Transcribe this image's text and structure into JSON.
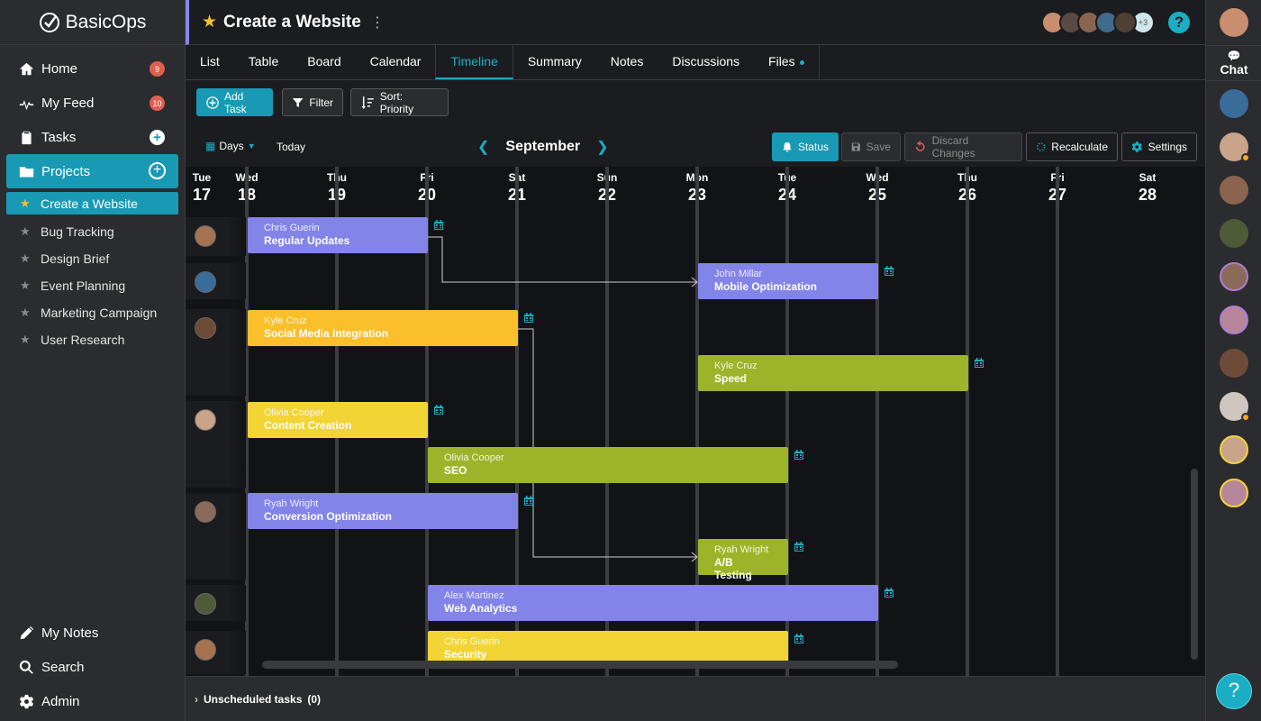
{
  "app": {
    "name": "BasicOps"
  },
  "sidebar": {
    "nav": [
      {
        "label": "Home",
        "icon": "home-icon",
        "badge": "9"
      },
      {
        "label": "My Feed",
        "icon": "activity-icon",
        "badge": "10"
      },
      {
        "label": "Tasks",
        "icon": "clipboard-icon"
      },
      {
        "label": "Projects",
        "icon": "folder-icon"
      }
    ],
    "projects": [
      {
        "label": "Create a Website",
        "starred": true
      },
      {
        "label": "Bug Tracking",
        "starred": false
      },
      {
        "label": "Design Brief",
        "starred": false
      },
      {
        "label": "Event Planning",
        "starred": false
      },
      {
        "label": "Marketing Campaign",
        "starred": false
      },
      {
        "label": "User Research",
        "starred": false
      }
    ],
    "bottom": [
      {
        "label": "My Notes",
        "icon": "pencil-icon"
      },
      {
        "label": "Search",
        "icon": "search-icon"
      },
      {
        "label": "Admin",
        "icon": "gear-icon"
      }
    ]
  },
  "header": {
    "title": "Create a Website",
    "more_members": "+3"
  },
  "tabs": [
    "List",
    "Table",
    "Board",
    "Calendar",
    "Timeline",
    "Summary",
    "Notes",
    "Discussions",
    "Files"
  ],
  "active_tab": "Timeline",
  "toolbar": {
    "add_task": "Add Task",
    "filter": "Filter",
    "sort": "Sort: Priority"
  },
  "timeline_controls": {
    "scale": "Days",
    "today": "Today",
    "month": "September",
    "status": "Status",
    "save": "Save",
    "discard": "Discard Changes",
    "recalculate": "Recalculate",
    "settings": "Settings"
  },
  "days": [
    {
      "dow": "Tue",
      "date": "17"
    },
    {
      "dow": "Wed",
      "date": "18"
    },
    {
      "dow": "Thu",
      "date": "19"
    },
    {
      "dow": "Fri",
      "date": "20"
    },
    {
      "dow": "Sat",
      "date": "21"
    },
    {
      "dow": "Sun",
      "date": "22"
    },
    {
      "dow": "Mon",
      "date": "23"
    },
    {
      "dow": "Tue",
      "date": "24"
    },
    {
      "dow": "Wed",
      "date": "25"
    },
    {
      "dow": "Thu",
      "date": "26"
    },
    {
      "dow": "Fri",
      "date": "27"
    },
    {
      "dow": "Sat",
      "date": "28"
    }
  ],
  "tasks": [
    {
      "assignee": "Chris Guerin",
      "name": "Regular Updates",
      "color": "#8384e8",
      "start": "18",
      "end": "19"
    },
    {
      "assignee": "John Millar",
      "name": "Mobile Optimization",
      "color": "#8384e8",
      "start": "23",
      "end": "24"
    },
    {
      "assignee": "Kyle Cruz",
      "name": "Social Media Integration",
      "color": "#fbbf2c",
      "start": "18",
      "end": "20"
    },
    {
      "assignee": "Kyle Cruz",
      "name": "Speed",
      "color": "#9db42a",
      "start": "23",
      "end": "25"
    },
    {
      "assignee": "Olivia Cooper",
      "name": "Content Creation",
      "color": "#f2d434",
      "start": "18",
      "end": "19"
    },
    {
      "assignee": "Olivia Cooper",
      "name": "SEO",
      "color": "#9db42a",
      "start": "20",
      "end": "23"
    },
    {
      "assignee": "Ryah Wright",
      "name": "Conversion Optimization",
      "color": "#8384e8",
      "start": "18",
      "end": "20"
    },
    {
      "assignee": "Ryah Wright",
      "name": "A/B Testing",
      "color": "#9db42a",
      "start": "23",
      "end": "23"
    },
    {
      "assignee": "Alex Martinez",
      "name": "Web Analytics",
      "color": "#8384e8",
      "start": "20",
      "end": "24"
    },
    {
      "assignee": "Chris Guerin",
      "name": "Security",
      "color": "#f2d434",
      "start": "20",
      "end": "23"
    }
  ],
  "unscheduled": {
    "label": "Unscheduled tasks",
    "count": "(0)"
  },
  "rail": {
    "chat_label": "Chat"
  },
  "colors": {
    "accent": "#1999b3",
    "purple": "#8384e8",
    "orange": "#fbbf2c",
    "yellow": "#f2d434",
    "green": "#9db42a"
  }
}
